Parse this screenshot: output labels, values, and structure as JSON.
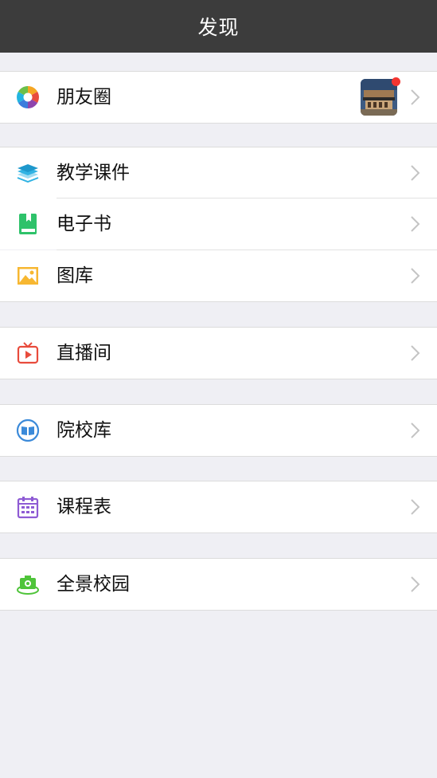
{
  "header": {
    "title": "发现"
  },
  "groups": [
    {
      "items": [
        {
          "label": "朋友圈",
          "icon": "moments-icon",
          "has_thumbnail": true,
          "has_badge": true
        }
      ]
    },
    {
      "items": [
        {
          "label": "教学课件",
          "icon": "courseware-icon"
        },
        {
          "label": "电子书",
          "icon": "ebook-icon"
        },
        {
          "label": "图库",
          "icon": "gallery-icon"
        }
      ]
    },
    {
      "items": [
        {
          "label": "直播间",
          "icon": "live-tv-icon"
        }
      ]
    },
    {
      "items": [
        {
          "label": "院校库",
          "icon": "school-library-icon"
        }
      ]
    },
    {
      "items": [
        {
          "label": "课程表",
          "icon": "calendar-icon"
        }
      ]
    },
    {
      "items": [
        {
          "label": "全景校园",
          "icon": "panorama-camera-icon"
        }
      ]
    }
  ],
  "colors": {
    "header_bg": "#3c3c3c",
    "page_bg": "#efeff4",
    "badge": "#f43530"
  }
}
